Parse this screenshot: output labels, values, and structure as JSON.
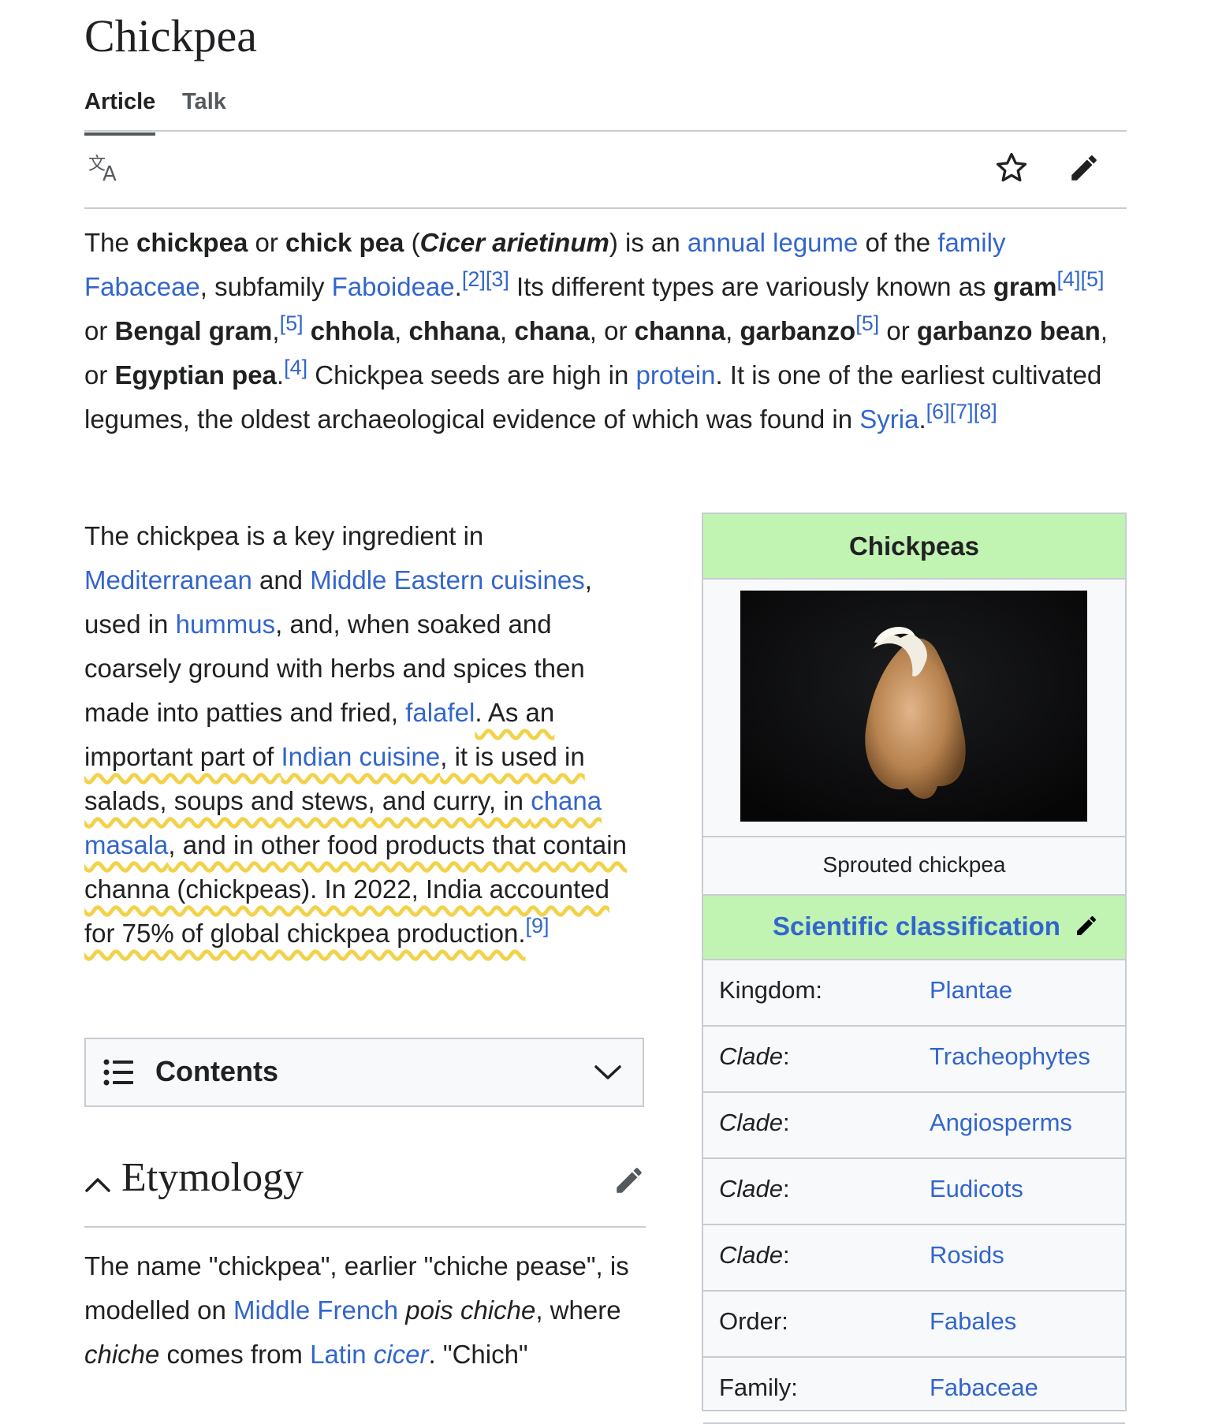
{
  "page": {
    "title": "Chickpea",
    "tabs": [
      {
        "label": "Article"
      },
      {
        "label": "Talk"
      }
    ]
  },
  "toolbar": {
    "language_icon": "translate-icon",
    "watch_icon": "star-icon",
    "edit_icon": "pencil-icon"
  },
  "lead": {
    "t1": "The ",
    "b1": "chickpea",
    "t2": " or ",
    "b2": "chick pea",
    "t3": " (",
    "bi1": "Cicer arietinum",
    "t4": ") is an ",
    "l_annual_legume": "annual legume",
    "t5": " of the ",
    "l_family": "family",
    "t6": " ",
    "l_fabaceae": "Fabaceae",
    "t7": ", subfamily ",
    "l_faboideae": "Faboideae",
    "t8": ".",
    "r2": "[2]",
    "r3": "[3]",
    "t9": " Its different types are variously known as ",
    "b_gram": "gram",
    "r4a": "[4]",
    "r5a": "[5]",
    "t10": " or ",
    "b_bengal": "Bengal gram",
    "t11": ",",
    "r5b": "[5]",
    "t12": " ",
    "b_chhola": "chhola",
    "t13": ", ",
    "b_chhana": "chhana",
    "t14": ", ",
    "b_chana": "chana",
    "t15": ", or ",
    "b_channa": "channa",
    "t16": ", ",
    "b_garbanzo": "garbanzo",
    "r5c": "[5]",
    "t17": " or ",
    "b_garbanzo_bean": "garbanzo bean",
    "t18": ", or ",
    "b_egyptian": "Egyptian pea",
    "t19": ".",
    "r4b": "[4]",
    "t20": " Chickpea seeds are high in ",
    "l_protein": "protein",
    "t21": ". It is one of the earliest cultivated legumes, the oldest archaeological evidence of which was found in ",
    "l_syria": "Syria",
    "t22": ".",
    "r6": "[6]",
    "r7": "[7]",
    "r8": "[8]"
  },
  "para2": {
    "t1": "The chickpea is a key ingredient in ",
    "l_mediterranean": "Mediterranean",
    "t2": " and ",
    "l_middle_eastern": "Middle Eastern cuisines",
    "t3": ", used in ",
    "l_hummus": "hummus",
    "t4": ", and, when soaked and coarsely ground with herbs and spices then made into patties and fried, ",
    "l_falafel": "falafel",
    "t5": ". As an important part of ",
    "l_indian": "Indian cuisine",
    "t6": ", it is used in salads, soups and stews, and curry, in ",
    "l_chana_masala": "chana masala",
    "t7": ", and in other food products that contain channa (chickpeas). In 2022, India accounted for 75% of global chickpea production.",
    "r9": "[9]"
  },
  "contents": {
    "label": "Contents",
    "list_icon": "list-icon",
    "chevron_icon": "chevron-down-icon"
  },
  "etymology": {
    "heading": "Etymology",
    "t1": "The name \"chickpea\", earlier \"chiche pease\", is modelled on ",
    "l_middle_french": "Middle French",
    "t2": " ",
    "i_pois": "pois chiche",
    "t3": ", where ",
    "i_chiche": "chiche",
    "t4": " comes from ",
    "l_latin": "Latin",
    "t5": " ",
    "l_cicer": "cicer",
    "t6": ". \"Chich\""
  },
  "infobox": {
    "title": "Chickpeas",
    "caption": "Sprouted chickpea",
    "sci_label": "Scientific classification",
    "rows": [
      {
        "key": "Kingdom:",
        "value": "Plantae"
      },
      {
        "key": "Clade",
        "colon": ":",
        "value": "Tracheophytes"
      },
      {
        "key": "Clade",
        "colon": ":",
        "value": "Angiosperms"
      },
      {
        "key": "Clade",
        "colon": ":",
        "value": "Eudicots"
      },
      {
        "key": "Clade",
        "colon": ":",
        "value": "Rosids"
      },
      {
        "key": "Order:",
        "value": "Fabales"
      },
      {
        "key": "Family:",
        "value": "Fabaceae"
      }
    ]
  },
  "colors": {
    "link": "#3366cc",
    "infobox_header": "#c1f3b3",
    "highlight": "#f2d24a"
  }
}
